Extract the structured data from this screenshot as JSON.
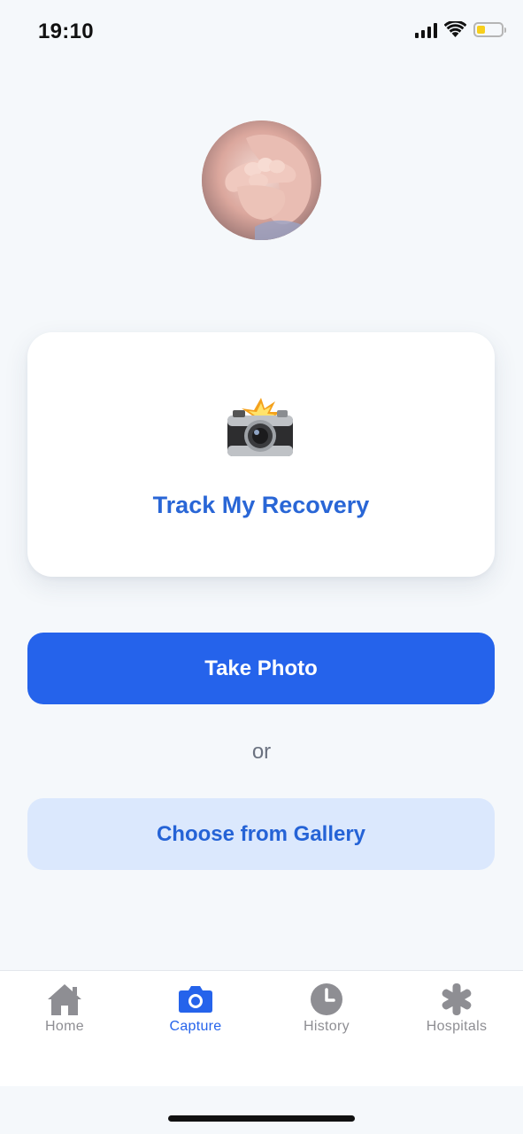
{
  "status_bar": {
    "time": "19:10",
    "icons": [
      "cellular-signal-icon",
      "wifi-icon",
      "battery-icon"
    ],
    "battery_color": "#f7cf1c"
  },
  "avatar": {
    "icon": "baby-hand-photo"
  },
  "card": {
    "icon": "camera-flash-icon",
    "title": "Track My Recovery"
  },
  "actions": {
    "take_photo_label": "Take Photo",
    "or_label": "or",
    "gallery_label": "Choose from Gallery"
  },
  "tab_bar": {
    "active": "Capture",
    "items": [
      {
        "label": "Home",
        "icon": "house-icon"
      },
      {
        "label": "Capture",
        "icon": "camera-icon"
      },
      {
        "label": "History",
        "icon": "clock-icon"
      },
      {
        "label": "Hospitals",
        "icon": "asterisk-icon"
      }
    ]
  },
  "colors": {
    "accent": "#2563eb",
    "accent_light": "#dbe8fd",
    "background": "#f5f8fb",
    "inactive_tab": "#8e8e93"
  }
}
